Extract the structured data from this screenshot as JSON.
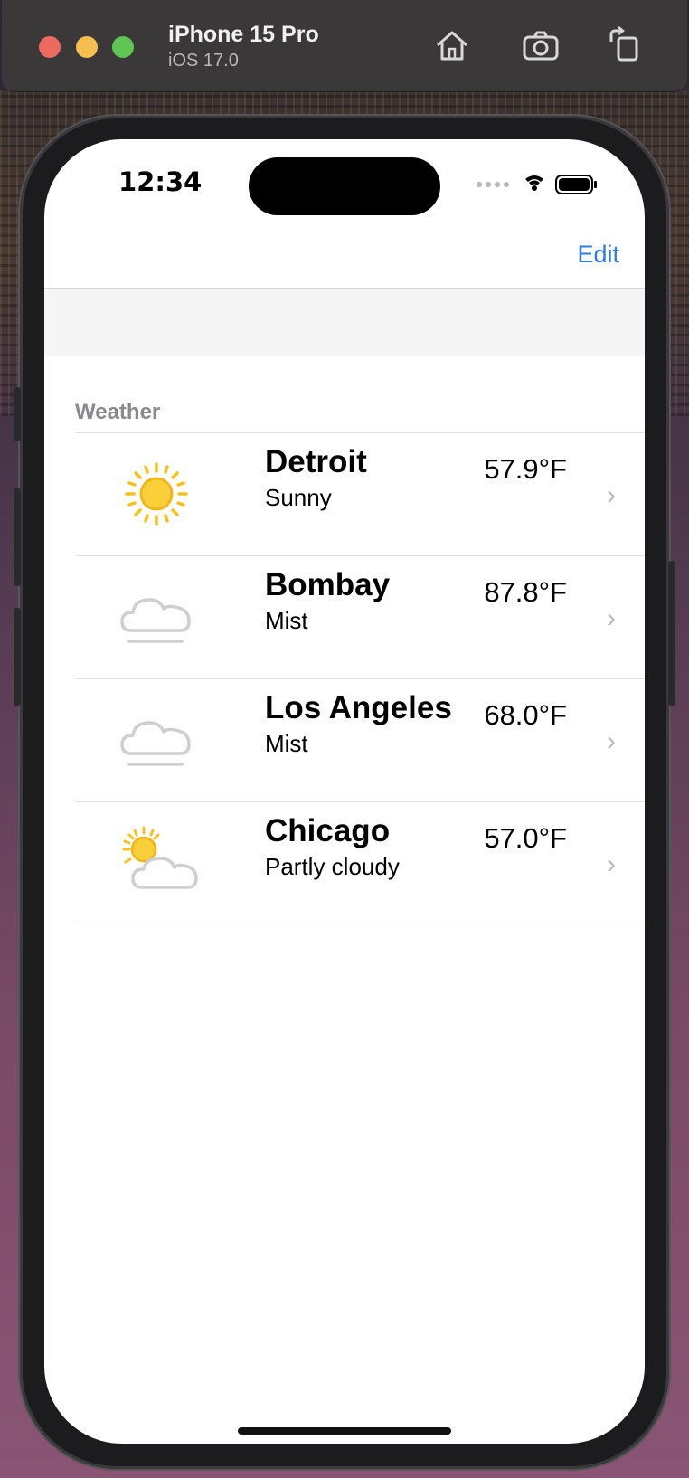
{
  "simulator": {
    "device_name": "iPhone 15 Pro",
    "os_version": "iOS 17.0"
  },
  "status_bar": {
    "time": "12:34"
  },
  "nav": {
    "edit_label": "Edit"
  },
  "section": {
    "header": "Weather"
  },
  "rows": [
    {
      "city": "Detroit",
      "condition": "Sunny",
      "temperature": "57.9°F",
      "icon": "sun-icon"
    },
    {
      "city": "Bombay",
      "condition": "Mist",
      "temperature": "87.8°F",
      "icon": "mist-icon"
    },
    {
      "city": "Los Angeles",
      "condition": "Mist",
      "temperature": "68.0°F",
      "icon": "mist-icon"
    },
    {
      "city": "Chicago",
      "condition": "Partly cloudy",
      "temperature": "57.0°F",
      "icon": "partly-cloudy-icon"
    }
  ],
  "colors": {
    "accent": "#2f7de1",
    "sun": "#f5c21b",
    "cloud_stroke": "#cfcfd2"
  }
}
